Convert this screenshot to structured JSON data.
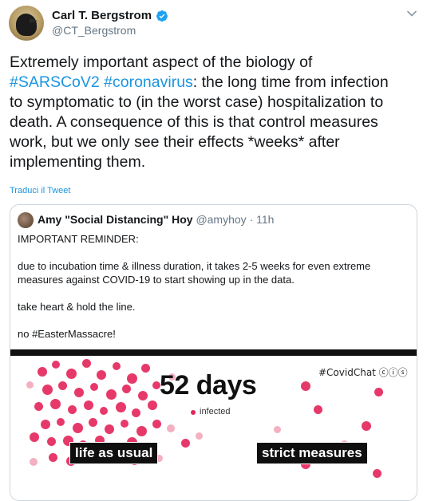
{
  "author": {
    "display_name": "Carl T. Bergstrom",
    "handle": "@CT_Bergstrom"
  },
  "icons": [
    "avatar",
    "verified-badge-icon",
    "chevron-down-icon"
  ],
  "tweet": {
    "line1": "Extremely important aspect of the biology of",
    "tag1": "#SARSCoV2",
    "tag2": "#coronavirus",
    "after_tags": ": the long time from infection",
    "line3": "to symptomatic to (in the worst case) hospitalization to",
    "line4": "death. A consequence of this is that control measures",
    "line5": "work, but we only see their effects *weeks* after",
    "line6": "implementing them.",
    "translate_label": "Traduci il Tweet"
  },
  "quoted": {
    "display_name": "Amy \"Social Distancing\" Hoy",
    "handle": "@amyhoy",
    "separator": "·",
    "time": "11h",
    "paragraphs": [
      "IMPORTANT REMINDER:",
      "due to incubation time & illness duration, it takes 2-5 weeks for even extreme measures against COVID-19 to start showing up in the data.",
      "take heart & hold the line.",
      "no #EasterMassacre!"
    ],
    "media": {
      "watermark": "#CovidChat ⓒⓘⓢ",
      "counter": "52 days",
      "counter_label": "infected",
      "left_label": "life as usual",
      "right_label": "strict measures",
      "dot_color": "#e3245a"
    }
  },
  "colors": {
    "link": "#1b95e0",
    "secondary_text": "#657786",
    "verified": "#1da1f2"
  }
}
